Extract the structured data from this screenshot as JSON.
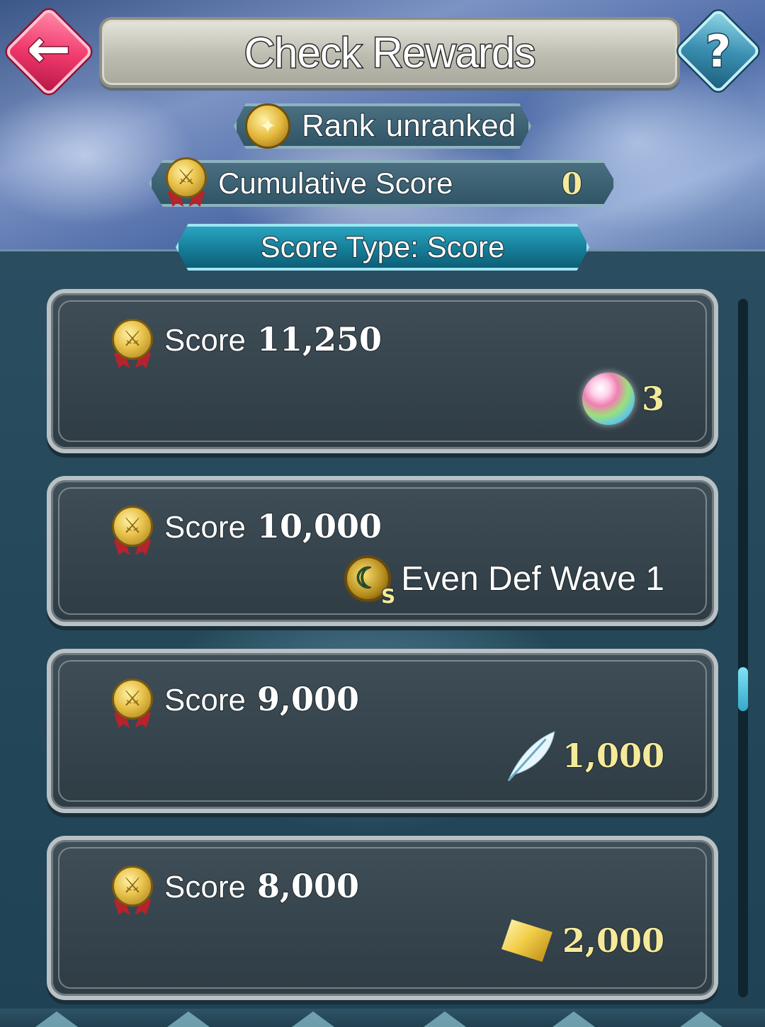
{
  "header": {
    "title": "Check Rewards",
    "back_icon": "back-arrow-icon",
    "help_label": "?"
  },
  "rank": {
    "label": "Rank",
    "value": "unranked",
    "icon": "rank-badge-icon"
  },
  "cumulative": {
    "label": "Cumulative Score",
    "value": "0",
    "icon": "score-medal-icon"
  },
  "score_type": {
    "label": "Score Type: Score"
  },
  "rewards": [
    {
      "label": "Score",
      "score": "11,250",
      "reward_icon": "orb-icon",
      "reward_value": "3"
    },
    {
      "label": "Score",
      "score": "10,000",
      "reward_icon": "sacred-seal-icon",
      "reward_value": "Even Def Wave 1",
      "badge": "S"
    },
    {
      "label": "Score",
      "score": "9,000",
      "reward_icon": "feather-icon",
      "reward_value": "1,000"
    },
    {
      "label": "Score",
      "score": "8,000",
      "reward_icon": "crystal-icon",
      "reward_value": "2,000"
    }
  ],
  "colors": {
    "accent_gold": "#f4ea9a",
    "back_button": "#f23a6d",
    "help_button": "#3a8fb1",
    "score_type_pill": "#167d98"
  }
}
